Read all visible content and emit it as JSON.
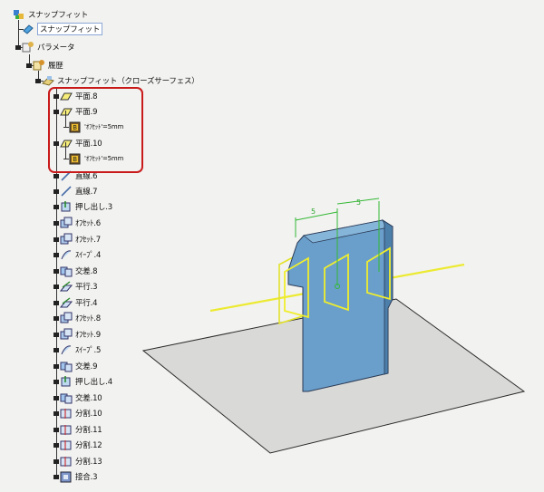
{
  "tree": {
    "root": "スナップフィット",
    "items": [
      {
        "label": "スナップフィット",
        "icon": "body-icon"
      },
      {
        "label": "パラメータ",
        "icon": "parameters-icon"
      },
      {
        "label": "履歴",
        "icon": "history-icon"
      },
      {
        "label": "スナップフィット（クローズサーフェス）",
        "icon": "closed-surface-icon"
      },
      {
        "label": "平面.8",
        "icon": "plane-icon"
      },
      {
        "label": "平面.9",
        "icon": "plane-icon"
      },
      {
        "label": "'ｵﾌｾｯﾄ'=5mm",
        "icon": "formula-icon"
      },
      {
        "label": "平面.10",
        "icon": "plane-icon"
      },
      {
        "label": "'ｵﾌｾｯﾄ'=5mm",
        "icon": "formula-icon"
      },
      {
        "label": "直線.6",
        "icon": "line-icon"
      },
      {
        "label": "直線.7",
        "icon": "line-icon"
      },
      {
        "label": "押し出し.3",
        "icon": "extrude-icon"
      },
      {
        "label": "ｵﾌｾｯﾄ.6",
        "icon": "offset-icon"
      },
      {
        "label": "ｵﾌｾｯﾄ.7",
        "icon": "offset-icon"
      },
      {
        "label": "ｽｲｰﾌﾟ.4",
        "icon": "sweep-icon"
      },
      {
        "label": "交差.8",
        "icon": "intersect-icon"
      },
      {
        "label": "平行.3",
        "icon": "parallel-icon"
      },
      {
        "label": "平行.4",
        "icon": "parallel-icon"
      },
      {
        "label": "ｵﾌｾｯﾄ.8",
        "icon": "offset-icon"
      },
      {
        "label": "ｵﾌｾｯﾄ.9",
        "icon": "offset-icon"
      },
      {
        "label": "ｽｲｰﾌﾟ.5",
        "icon": "sweep-icon"
      },
      {
        "label": "交差.9",
        "icon": "intersect-icon"
      },
      {
        "label": "押し出し.4",
        "icon": "extrude-icon"
      },
      {
        "label": "交差.10",
        "icon": "intersect-icon"
      },
      {
        "label": "分割.10",
        "icon": "split-icon"
      },
      {
        "label": "分割.11",
        "icon": "split-icon"
      },
      {
        "label": "分割.12",
        "icon": "split-icon"
      },
      {
        "label": "分割.13",
        "icon": "split-icon"
      },
      {
        "label": "接合.3",
        "icon": "join-icon"
      }
    ]
  },
  "viewport": {
    "dimension_label_1": "5",
    "dimension_label_2": "5"
  },
  "colors": {
    "highlight": "#c91a1a",
    "part_fill": "#6a9fcb",
    "plane_outline": "#e7e62d",
    "dimension": "#33b833",
    "ground": "#d9d9d7"
  }
}
